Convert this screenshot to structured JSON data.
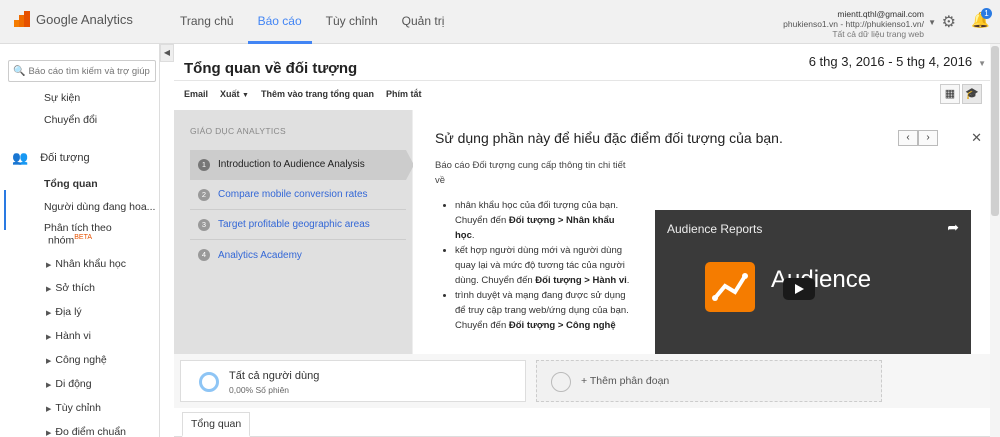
{
  "app": {
    "name": "Google Analytics",
    "accent": "#4285f4"
  },
  "nav": {
    "items": [
      {
        "label": "Trang chủ",
        "active": false
      },
      {
        "label": "Báo cáo",
        "active": true
      },
      {
        "label": "Tùy chỉnh",
        "active": false
      },
      {
        "label": "Quản trị",
        "active": false
      }
    ]
  },
  "account": {
    "email": "mientt.qthl@gmail.com",
    "property": "phukienso1.vn - http://phukienso1.vn/",
    "view": "Tất cả dữ liệu trang web"
  },
  "notifications": {
    "count": "1"
  },
  "sidebar": {
    "search_placeholder": "Báo cáo tìm kiếm và trợ giúp",
    "items": [
      {
        "label": "Sự kiện"
      },
      {
        "label": "Chuyển đổi"
      },
      {
        "label": "Đối tượng"
      },
      {
        "label": "Tổng quan"
      },
      {
        "label": "Người dùng đang hoa..."
      },
      {
        "label": "Phân tích theo"
      },
      {
        "label": "nhóm"
      },
      {
        "label": "BETA"
      },
      {
        "label": "Nhân khẩu học"
      },
      {
        "label": "Sở thích"
      },
      {
        "label": "Địa lý"
      },
      {
        "label": "Hành vi"
      },
      {
        "label": "Công nghệ"
      },
      {
        "label": "Di động"
      },
      {
        "label": "Tùy chỉnh"
      },
      {
        "label": "Đo điểm chuẩn"
      }
    ]
  },
  "page": {
    "title": "Tổng quan về đối tượng",
    "date_range": "6 thg 3, 2016 - 5 thg 4, 2016",
    "actions": [
      "Email",
      "Xuất",
      "Thêm vào trang tổng quan",
      "Phím tắt"
    ]
  },
  "education": {
    "header": "GIÁO DỤC ANALYTICS",
    "lessons": [
      {
        "num": "1",
        "label": "Introduction to Audience Analysis"
      },
      {
        "num": "2",
        "label": "Compare mobile conversion rates"
      },
      {
        "num": "3",
        "label": "Target profitable geographic areas"
      },
      {
        "num": "4",
        "label": "Analytics Academy"
      }
    ],
    "heading": "Sử dụng phần này để hiểu đặc điểm đối tượng của bạn.",
    "intro": "Báo cáo Đối tượng cung cấp thông tin chi tiết về",
    "bullets": [
      {
        "text": "nhân khẩu học của đối tượng của bạn. Chuyển đến ",
        "link": "Đối tượng > Nhân khẩu học",
        "end": "."
      },
      {
        "text": "kết hợp người dùng mới và người dùng quay lại và mức độ tương tác của người dùng. Chuyển đến ",
        "link": "Đối tượng > Hành vi",
        "end": "."
      },
      {
        "text": "trình duyệt và mạng đang được sử dụng để truy cập trang web/ứng dụng của bạn. Chuyển đến ",
        "link": "Đối tượng > Công nghệ",
        "end": ""
      }
    ],
    "video": {
      "title": "Audience Reports",
      "word": "Audience"
    }
  },
  "segments": {
    "active": {
      "name": "Tất cả người dùng",
      "sub": "0,00% Số phiên"
    },
    "add_label": "+ Thêm phân đoạn"
  },
  "tabs": {
    "overview": "Tổng quan"
  }
}
